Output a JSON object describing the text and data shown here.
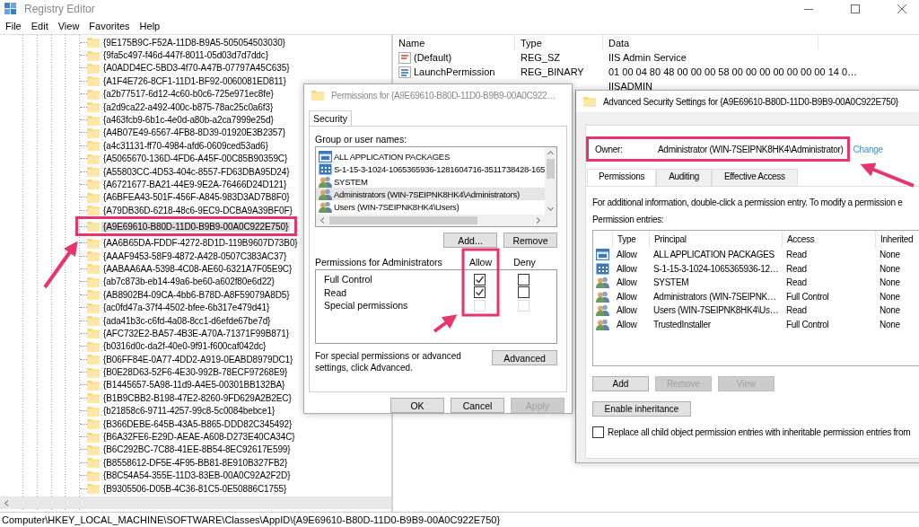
{
  "window": {
    "title": "Registry Editor"
  },
  "menu": [
    "File",
    "Edit",
    "View",
    "Favorites",
    "Help"
  ],
  "tree": {
    "items": [
      {
        "label": "{9E175B9C-F52A-11D8-B9A5-505054503030}",
        "selected": false
      },
      {
        "label": "{9fa5c497-f46d-447f-8011-05d03d7d7ddc}",
        "selected": false
      },
      {
        "label": "{A0ADD4EC-5BD3-4f70-A47B-07797A45C635}",
        "selected": false
      },
      {
        "label": "{A1F4E726-8CF1-11D1-BF92-0060081ED811}",
        "selected": false
      },
      {
        "label": "{a2b77517-6d12-4c60-b0c6-725e971ec8fe}",
        "selected": false
      },
      {
        "label": "{a2d9ca22-a492-400c-b875-78ac25c0a6f3}",
        "selected": false
      },
      {
        "label": "{a463fcb9-6b1c-4e0d-a80b-a2ca7999e25d}",
        "selected": false
      },
      {
        "label": "{A4B07E49-6567-4FB8-8D39-01920E3B2357}",
        "selected": false
      },
      {
        "label": "{a4c31131-ff70-4984-afd6-0609ced53ad6}",
        "selected": false
      },
      {
        "label": "{A5065670-136D-4FD6-A45F-00C85B90359C}",
        "selected": false
      },
      {
        "label": "{A55803CC-4D53-404c-8557-FD63DBA95D24}",
        "selected": false
      },
      {
        "label": "{A6721677-BA21-44E9-9E2A-76466D24D121}",
        "selected": false
      },
      {
        "label": "{A6BFEA43-501F-456F-A845-983D3AD7B8F0}",
        "selected": false
      },
      {
        "label": "{A79DB36D-6218-48c6-9EC9-DCBA9A39BF0F}",
        "selected": false
      },
      {
        "label": "{A9E69610-B80D-11D0-B9B9-00A0C922E750}",
        "selected": true
      },
      {
        "label": "{AA6B65DA-FDDF-4272-8D1D-119B9607D73B0}",
        "selected": false
      },
      {
        "label": "{AAAF9453-58F9-4872-A428-0507C383AC37}",
        "selected": false
      },
      {
        "label": "{AABAA6AA-5398-4C08-AE60-6321A7F05E9C}",
        "selected": false
      },
      {
        "label": "{ab7c873b-eb14-49a6-be60-a602f80e6d22}",
        "selected": false
      },
      {
        "label": "{AB8902B4-09CA-4bb6-B78D-A8F59079A8D5}",
        "selected": false
      },
      {
        "label": "{ac0fd47a-37f4-4502-bfee-6b317e479d41}",
        "selected": false
      },
      {
        "label": "{ada41b3c-c6fd-4a08-8cc1-d6efde67be7d}",
        "selected": false
      },
      {
        "label": "{AFC732E2-BA57-4B3E-A70A-71371F99B871}",
        "selected": false
      },
      {
        "label": "{b0316d0c-da2f-40e0-9f91-f600caf042dc}",
        "selected": false
      },
      {
        "label": "{B06FF84E-0A77-4DD2-A919-0EABD8979DC1}",
        "selected": false
      },
      {
        "label": "{B0E28D63-52F6-4E30-992B-78ECF97268E9}",
        "selected": false
      },
      {
        "label": "{B1445657-5A98-11d9-A4E5-00301BB132BA}",
        "selected": false
      },
      {
        "label": "{B1B9CBB2-B198-47E2-8260-9FD629A2B2EC}",
        "selected": false
      },
      {
        "label": "{b21858c6-9711-4257-99c8-5c0084bebce1}",
        "selected": false
      },
      {
        "label": "{B366DEBE-645B-43A5-B865-DDD82C345492}",
        "selected": false
      },
      {
        "label": "{B6A32FE6-E29D-AEAE-A608-D273E40CA34C}",
        "selected": false
      },
      {
        "label": "{B6C292BC-7C88-41EE-8B54-8EC92617E599}",
        "selected": false
      },
      {
        "label": "{B8558612-DF5E-4F95-BB81-8E910B327FB2}",
        "selected": false
      },
      {
        "label": "{B8C54A54-355E-11D3-83EB-00A0C92A2F2D}",
        "selected": false
      },
      {
        "label": "{B9305506-D05B-4C36-81C5-0E50886C1755}",
        "selected": false
      }
    ]
  },
  "values": {
    "columns": [
      "Name",
      "Type",
      "Data"
    ],
    "rows": [
      {
        "kind": "string",
        "name": "(Default)",
        "type": "REG_SZ",
        "data": "IIS Admin Service"
      },
      {
        "kind": "binary",
        "name": "LaunchPermission",
        "type": "REG_BINARY",
        "data": "01 00 04 80 48 00 00 00 58 00 00 00 00 00 00 00 14 0…"
      },
      {
        "kind": "covered",
        "data": "IISADMIN"
      }
    ]
  },
  "status_bar": {
    "path": "Computer\\HKEY_LOCAL_MACHINE\\SOFTWARE\\Classes\\AppID\\{A9E69610-B80D-11D0-B9B9-00A0C922E750}"
  },
  "permissions_dialog": {
    "title": "Permissions for {A9E69610-B80D-11D0-B9B9-00A0C922…",
    "tab": "Security",
    "group_label": "Group or user names:",
    "principals": [
      {
        "kind": "package",
        "label": "ALL APPLICATION PACKAGES",
        "selected": false
      },
      {
        "kind": "sid",
        "label": "S-1-15-3-1024-1065365936-1281604716-3511738428-165",
        "selected": false
      },
      {
        "kind": "group",
        "label": "SYSTEM",
        "selected": false
      },
      {
        "kind": "group",
        "label": "Administrators (WIN-7SEIPNK8HK4\\Administrators)",
        "selected": true
      },
      {
        "kind": "group",
        "label": "Users (WIN-7SEIPNK8HK4\\Users)",
        "selected": false
      }
    ],
    "list_buttons": [
      {
        "label": "Add...",
        "disabled": false
      },
      {
        "label": "Remove",
        "disabled": false
      }
    ],
    "permissions_label": "Permissions for Administrators",
    "allow_label": "Allow",
    "deny_label": "Deny",
    "permissions": [
      {
        "label": "Full Control",
        "allow": {
          "checked": true,
          "disabled": false
        },
        "deny": {
          "checked": false,
          "disabled": false
        }
      },
      {
        "label": "Read",
        "allow": {
          "checked": true,
          "disabled": false
        },
        "deny": {
          "checked": false,
          "disabled": false
        }
      },
      {
        "label": "Special permissions",
        "allow": {
          "checked": false,
          "disabled": true
        },
        "deny": {
          "checked": false,
          "disabled": true
        }
      }
    ],
    "advanced_note": "For special permissions or advanced settings, click Advanced.",
    "advanced_button": "Advanced",
    "buttons": [
      {
        "label": "OK",
        "disabled": false
      },
      {
        "label": "Cancel",
        "disabled": false
      },
      {
        "label": "Apply",
        "disabled": true
      }
    ]
  },
  "advanced_dialog": {
    "title": "Advanced Security Settings for {A9E69610-B80D-11D0-B9B9-00A0C922E750}",
    "owner_label": "Owner:",
    "owner": "Administrator (WIN-7SEIPNK8HK4\\Administrator)",
    "change_link": "Change",
    "tabs": [
      {
        "label": "Permissions",
        "selected": true
      },
      {
        "label": "Auditing",
        "selected": false
      },
      {
        "label": "Effective Access",
        "selected": false
      }
    ],
    "info": "For additional information, double-click a permission entry. To modify a permission e",
    "entries_label": "Permission entries:",
    "columns": [
      "Type",
      "Principal",
      "Access",
      "Inherited"
    ],
    "entries": [
      {
        "kind": "package",
        "type": "Allow",
        "principal": "ALL APPLICATION PACKAGES",
        "access": "Read",
        "inherited": "None"
      },
      {
        "kind": "sid",
        "type": "Allow",
        "principal": "S-1-15-3-1024-1065365936-12…",
        "access": "Read",
        "inherited": "None"
      },
      {
        "kind": "group",
        "type": "Allow",
        "principal": "SYSTEM",
        "access": "Read",
        "inherited": "None"
      },
      {
        "kind": "group",
        "type": "Allow",
        "principal": "Administrators (WIN-7SEIPNK…",
        "access": "Full Control",
        "inherited": "None"
      },
      {
        "kind": "group",
        "type": "Allow",
        "principal": "Users (WIN-7SEIPNK8HK4\\Us…",
        "access": "Read",
        "inherited": "None"
      },
      {
        "kind": "group",
        "type": "Allow",
        "principal": "TrustedInstaller",
        "access": "Full Control",
        "inherited": "None"
      }
    ],
    "buttons": [
      {
        "label": "Add",
        "disabled": false
      },
      {
        "label": "Remove",
        "disabled": true
      },
      {
        "label": "View",
        "disabled": true
      }
    ],
    "inheritance_button": "Enable inheritance",
    "replace": {
      "label": "Replace all child object permission entries with inheritable permission entries from",
      "checked": false
    }
  }
}
